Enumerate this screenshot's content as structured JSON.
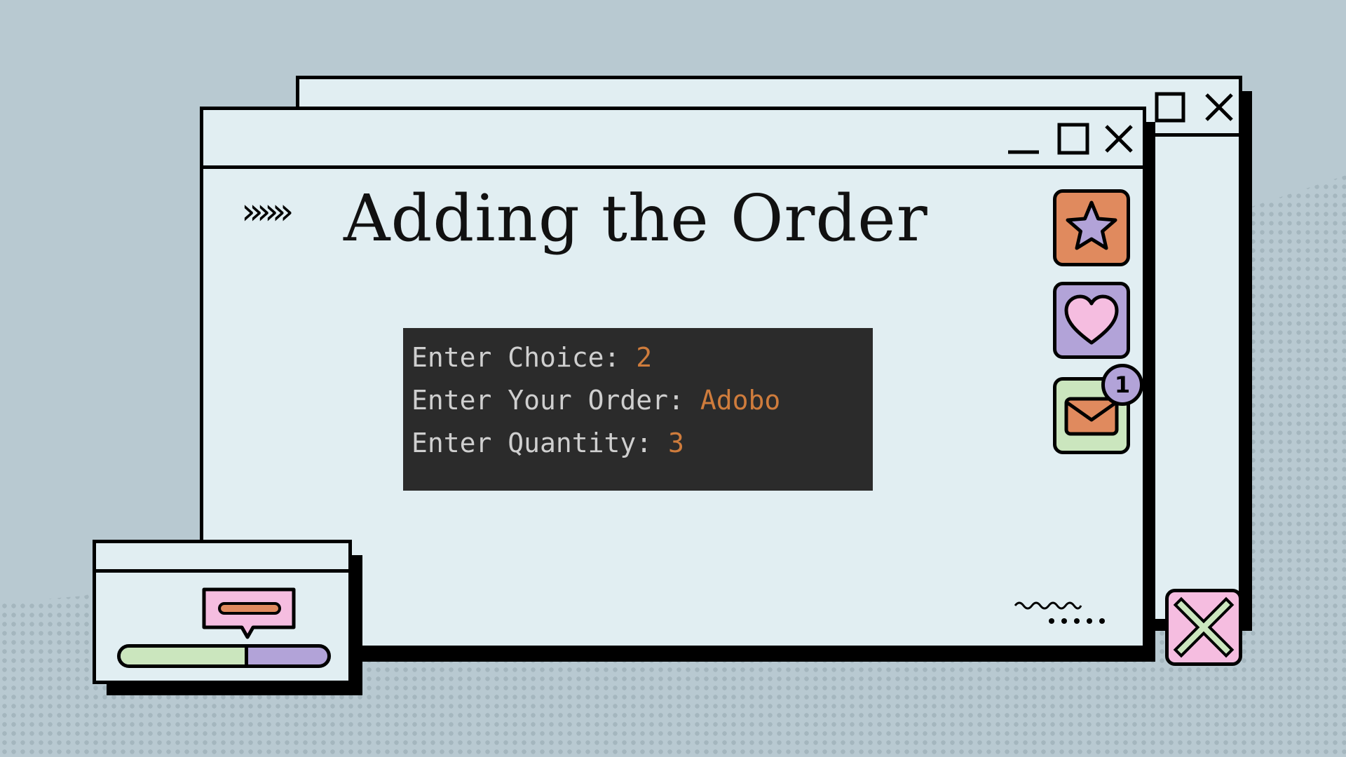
{
  "window": {
    "title": "Adding the Order",
    "chevrons": "»»»"
  },
  "console": {
    "lines": [
      {
        "prompt": "Enter Choice: ",
        "value": "2"
      },
      {
        "prompt": "Enter Your Order: ",
        "value": "Adobo"
      },
      {
        "prompt": "Enter Quantity: ",
        "value": "3"
      }
    ]
  },
  "side_icons": {
    "icons": [
      "star-icon",
      "heart-icon",
      "mail-icon"
    ],
    "mail_badge": "1"
  },
  "progress": {
    "fraction": 0.6
  },
  "colors": {
    "background": "#b8c9d1",
    "window": "#e1eef2",
    "console_bg": "#2b2b2b",
    "console_text": "#cfcfcf",
    "console_value": "#cf7c3c",
    "orange": "#e08a5e",
    "purple": "#b2a3d8",
    "pink": "#f5bde0",
    "green": "#cbe6be"
  }
}
